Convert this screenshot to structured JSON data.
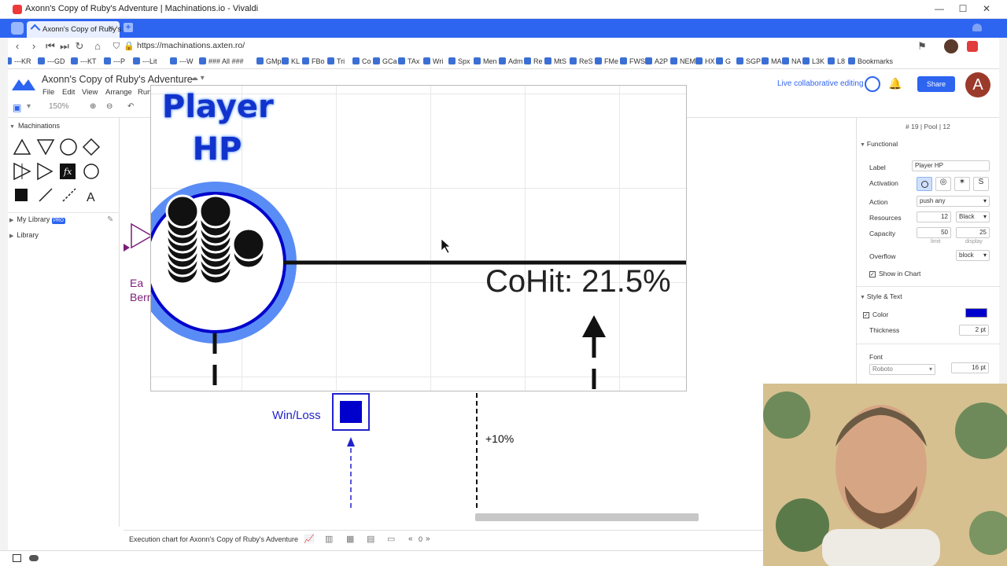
{
  "window": {
    "title": "Axonn's Copy of Ruby's Adventure | Machinations.io - Vivaldi",
    "tab_label": "Axonn's Copy of Ruby's Ad",
    "url": "https://machinations.axten.ro/",
    "minimize": "—",
    "maximize": "☐",
    "close": "✕"
  },
  "bookmarks": [
    "---KR",
    "---GD",
    "---KT",
    "---P",
    "---Lit",
    "---W",
    "### All ###",
    "GMp",
    "KL",
    "FBo",
    "Tri",
    "Co",
    "GCa",
    "TAx",
    "Wri",
    "Spx",
    "Men",
    "Adm",
    "Re",
    "MtS",
    "ReS",
    "FMe",
    "FWS",
    "A2P",
    "NEM",
    "HX",
    "G",
    "SGP",
    "MA",
    "NA",
    "L3K",
    "L8",
    "Bookmarks"
  ],
  "app": {
    "doc_title": "Axonn's Copy of Ruby's Adventure",
    "menus": [
      "File",
      "Edit",
      "View",
      "Arrange",
      "Run"
    ],
    "zoom": "150%",
    "collab_label": "Live collaborative editing",
    "share_label": "Share",
    "avatar_letter": "A"
  },
  "left_panel": {
    "machinations_label": "Machinations",
    "my_library_label": "My Library",
    "pro_badge": "PRO",
    "library_label": "Library"
  },
  "canvas": {
    "player_hp_line1": "Player",
    "player_hp_line2": "HP",
    "cohit_label": "CoHit: 21.5%",
    "winloss_label": "Win/Loss",
    "plus10_label": "+10%",
    "partial_label1": "Ea",
    "partial_label2": "Berr"
  },
  "right_panel": {
    "header": "# 19 | Pool | 12",
    "functional_label": "Functional",
    "label_label": "Label",
    "label_value": "Player HP",
    "activation_label": "Activation",
    "action_label": "Action",
    "action_value": "push any",
    "resources_label": "Resources",
    "resources_value": "12",
    "resources_color": "Black",
    "capacity_label": "Capacity",
    "capacity_limit": "50",
    "capacity_display": "25",
    "limit_caption": "limit",
    "display_caption": "display",
    "overflow_label": "Overflow",
    "overflow_value": "block",
    "show_in_chart": "Show in Chart",
    "style_text_label": "Style & Text",
    "color_label": "Color",
    "color_value": "#0000cc",
    "thickness_label": "Thickness",
    "thickness_value": "2 pt",
    "font_label": "Font",
    "font_value": "Roboto",
    "font_size_value": "16 pt"
  },
  "bottom": {
    "execution_label": "Execution chart for Axonn's Copy of Ruby's Adventure",
    "page_count": "0"
  }
}
